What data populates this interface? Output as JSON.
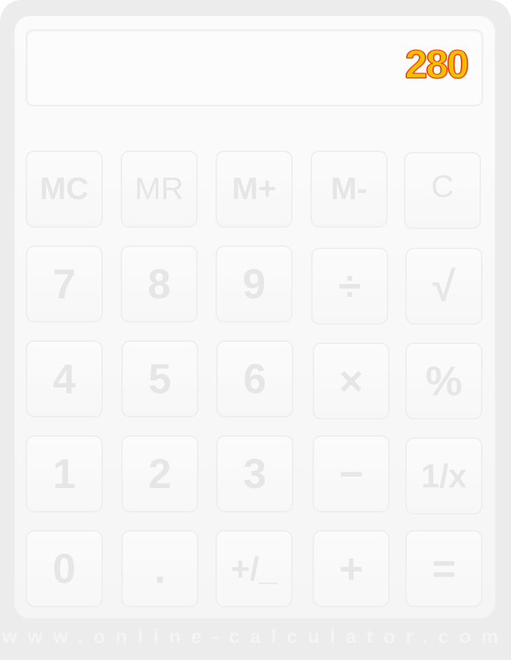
{
  "display": {
    "value": "280"
  },
  "keys": {
    "mc": "MC",
    "mr": "MR",
    "m_plus": "M+",
    "m_minus": "M-",
    "clear": "C",
    "seven": "7",
    "eight": "8",
    "nine": "9",
    "divide": "÷",
    "sqrt": "√",
    "four": "4",
    "five": "5",
    "six": "6",
    "multiply": "×",
    "percent": "%",
    "one": "1",
    "two": "2",
    "three": "3",
    "minus": "−",
    "reciprocal": "1/x",
    "zero": "0",
    "dot": ".",
    "negate": "+/_",
    "plus": "+",
    "equals": "="
  },
  "footer": {
    "text": "www.online-calculator.com"
  },
  "colors": {
    "frame": "#ececec",
    "body": "#f8f8f8",
    "key_text": "#e6e6e6",
    "display_text": "#f0c000",
    "display_outline": "#ff2a00"
  }
}
